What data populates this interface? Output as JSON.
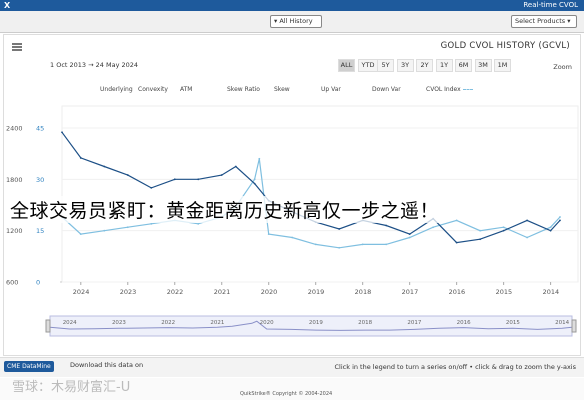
{
  "window": {
    "close": "X",
    "title": "Real-time CVOL"
  },
  "toolbar": {
    "products": "Select Products",
    "history": "All History"
  },
  "chart_header": {
    "title": "GOLD CVOL HISTORY (GCVL)",
    "date_from": "1 Oct 2013",
    "date_to": "24 May 2024",
    "date_sep": "→",
    "zoom_label": "Zoom",
    "zoom_buttons": [
      "1M",
      "3M",
      "6M",
      "1Y",
      "2Y",
      "3Y",
      "5Y",
      "YTD",
      "ALL"
    ],
    "zoom_selected": "ALL"
  },
  "legend": [
    "CVOL Index",
    "Down Var",
    "Up Var",
    "Skew",
    "Skew Ratio",
    "ATM",
    "Convexity",
    "Underlying"
  ],
  "overlay_text": "全球交易员紧盯：黄金距离历史新高仅一步之遥！",
  "bottom": {
    "download_label": "Download this data on",
    "datamine_label": "CME DataMine",
    "hint": "Click in the legend to turn a series on/off • click & drag to zoom the y-axis"
  },
  "footer": {
    "watermark": "雪球：木易财富汇-U",
    "copyright": "QuikStrike® Copyright © 2004-2024"
  },
  "colors": {
    "cvol": "#7fbfe0",
    "underlying": "#1c4f86",
    "navigator": "#8a90c8"
  },
  "chart_data": {
    "type": "line",
    "title": "GOLD CVOL HISTORY (GCVL)",
    "x_reversed": true,
    "x_ticks": [
      "2024",
      "2023",
      "2022",
      "2021",
      "2020",
      "2019",
      "2018",
      "2017",
      "2016",
      "2015",
      "2014"
    ],
    "y_left_ticks": [
      "2400",
      "1800",
      "1200",
      "600"
    ],
    "y_left_range": [
      600,
      2400
    ],
    "y_right_ticks": [
      "45",
      "30",
      "15",
      "0"
    ],
    "y_right_range": [
      0,
      45
    ],
    "series": [
      {
        "name": "CVOL Index",
        "axis": "right",
        "x": [
          2024.4,
          2024.0,
          2023.5,
          2023.0,
          2022.5,
          2022.0,
          2021.5,
          2021.0,
          2020.7,
          2020.3,
          2020.2,
          2020.0,
          2019.5,
          2019.0,
          2018.5,
          2018.0,
          2017.5,
          2017.0,
          2016.5,
          2016.0,
          2015.5,
          2015.0,
          2014.5,
          2014.0,
          2013.8
        ],
        "y": [
          19,
          14,
          15,
          16,
          17,
          18,
          17,
          19,
          22,
          30,
          36,
          14,
          13,
          11,
          10,
          11,
          11,
          13,
          16,
          18,
          15,
          16,
          13,
          16,
          19
        ]
      },
      {
        "name": "Underlying",
        "axis": "left",
        "x": [
          2024.4,
          2024.0,
          2023.5,
          2023.0,
          2022.5,
          2022.0,
          2021.5,
          2021.0,
          2020.7,
          2020.3,
          2020.0,
          2019.5,
          2019.0,
          2018.5,
          2018.0,
          2017.5,
          2017.0,
          2016.5,
          2016.0,
          2015.5,
          2015.0,
          2014.5,
          2014.0,
          2013.8
        ],
        "y": [
          2350,
          2050,
          1950,
          1850,
          1700,
          1800,
          1800,
          1850,
          1950,
          1750,
          1550,
          1420,
          1300,
          1220,
          1320,
          1260,
          1160,
          1340,
          1060,
          1100,
          1200,
          1320,
          1200,
          1320
        ]
      }
    ]
  }
}
